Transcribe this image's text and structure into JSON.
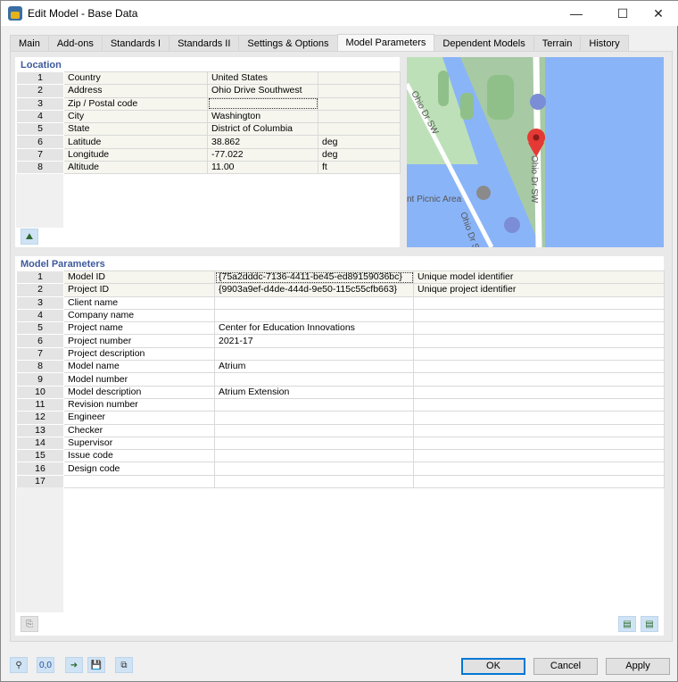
{
  "window": {
    "title": "Edit Model - Base Data",
    "minimize": "—",
    "maximize": "☐",
    "close": "✕"
  },
  "tabs": [
    {
      "label": "Main"
    },
    {
      "label": "Add-ons"
    },
    {
      "label": "Standards I"
    },
    {
      "label": "Standards II"
    },
    {
      "label": "Settings & Options"
    },
    {
      "label": "Model Parameters",
      "active": true
    },
    {
      "label": "Dependent Models"
    },
    {
      "label": "Terrain"
    },
    {
      "label": "History"
    }
  ],
  "location": {
    "title": "Location",
    "rows": [
      {
        "n": "1",
        "label": "Country",
        "value": "United States",
        "unit": ""
      },
      {
        "n": "2",
        "label": "Address",
        "value": "Ohio Drive Southwest",
        "unit": ""
      },
      {
        "n": "3",
        "label": "Zip / Postal code",
        "value": "",
        "unit": ""
      },
      {
        "n": "4",
        "label": "City",
        "value": "Washington",
        "unit": ""
      },
      {
        "n": "5",
        "label": "State",
        "value": "District of Columbia",
        "unit": ""
      },
      {
        "n": "6",
        "label": "Latitude",
        "value": "38.862",
        "unit": "deg"
      },
      {
        "n": "7",
        "label": "Longitude",
        "value": "-77.022",
        "unit": "deg"
      },
      {
        "n": "8",
        "label": "Altitude",
        "value": "11.00",
        "unit": "ft"
      }
    ]
  },
  "map": {
    "labels": [
      "Ohio Dr SW",
      "Ohio Dr SW",
      "Ohio Dr SW",
      "nt Picnic Area"
    ],
    "water_color": "#8ab4f8",
    "land_color": "#c8e6c9"
  },
  "params": {
    "title": "Model Parameters",
    "rows": [
      {
        "n": "1",
        "label": "Model ID",
        "value": "{75a2dddc-7136-4411-be45-ed89159036bc}",
        "desc": "Unique model identifier"
      },
      {
        "n": "2",
        "label": "Project ID",
        "value": "{9903a9ef-d4de-444d-9e50-115c55cfb663}",
        "desc": "Unique project identifier"
      },
      {
        "n": "3",
        "label": "Client name",
        "value": "",
        "desc": ""
      },
      {
        "n": "4",
        "label": "Company name",
        "value": "",
        "desc": ""
      },
      {
        "n": "5",
        "label": "Project name",
        "value": "Center for Education Innovations",
        "desc": ""
      },
      {
        "n": "6",
        "label": "Project number",
        "value": "2021-17",
        "desc": ""
      },
      {
        "n": "7",
        "label": "Project description",
        "value": "",
        "desc": ""
      },
      {
        "n": "8",
        "label": "Model name",
        "value": "Atrium",
        "desc": ""
      },
      {
        "n": "9",
        "label": "Model number",
        "value": "",
        "desc": ""
      },
      {
        "n": "10",
        "label": "Model description",
        "value": "Atrium Extension",
        "desc": ""
      },
      {
        "n": "11",
        "label": "Revision number",
        "value": "",
        "desc": ""
      },
      {
        "n": "12",
        "label": "Engineer",
        "value": "",
        "desc": ""
      },
      {
        "n": "13",
        "label": "Checker",
        "value": "",
        "desc": ""
      },
      {
        "n": "14",
        "label": "Supervisor",
        "value": "",
        "desc": ""
      },
      {
        "n": "15",
        "label": "Issue code",
        "value": "",
        "desc": ""
      },
      {
        "n": "16",
        "label": "Design code",
        "value": "",
        "desc": ""
      },
      {
        "n": "17",
        "label": "",
        "value": "",
        "desc": ""
      }
    ]
  },
  "buttons": {
    "ok": "OK",
    "cancel": "Cancel",
    "apply": "Apply"
  }
}
